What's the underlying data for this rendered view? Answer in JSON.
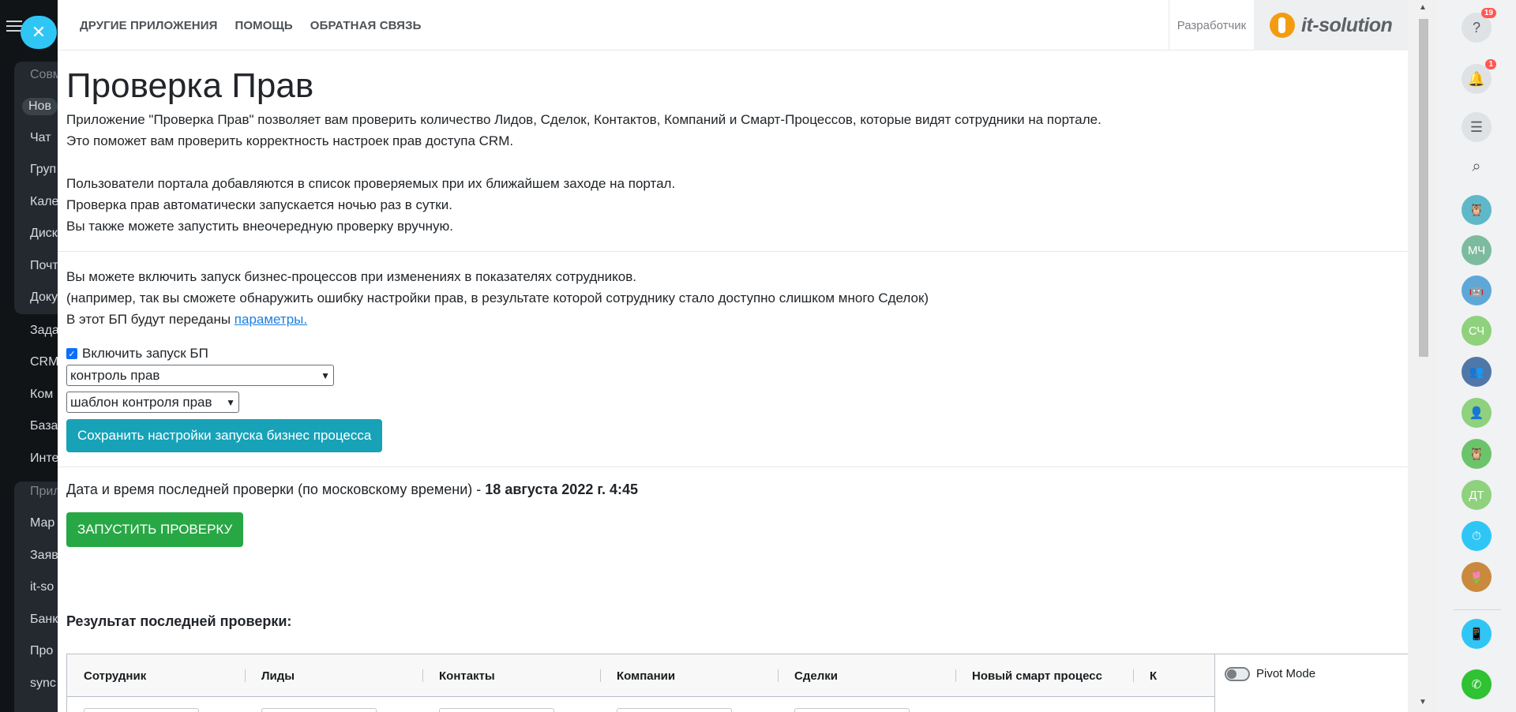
{
  "left_menu": {
    "items": [
      "Совм",
      "Нов",
      "Чат",
      "Груп",
      "Кале",
      "Диск",
      "Почт",
      "Доку",
      "Зада",
      "CRM",
      "Ком",
      "База",
      "Инте",
      "Прил",
      "Мар",
      "Заяв",
      "it-so",
      "Банк",
      "Про",
      "sync"
    ]
  },
  "topnav": {
    "links": [
      "ДРУГИЕ ПРИЛОЖЕНИЯ",
      "ПОМОЩЬ",
      "ОБРАТНАЯ СВЯЗЬ"
    ],
    "developer": "Разработчик",
    "logo": "it-solution"
  },
  "page": {
    "title": "Проверка Прав",
    "intro": [
      "Приложение \"Проверка Прав\" позволяет вам проверить количество Лидов, Сделок, Контактов, Компаний и Смарт-Процессов, которые видят сотрудники на портале.",
      "Это поможет вам проверить корректность настроек прав доступа CRM."
    ],
    "info": [
      "Пользователи портала добавляются в список проверяемых при их ближайшем заходе на портал.",
      "Проверка прав автоматически запускается ночью раз в сутки.",
      "Вы также можете запустить внеочередную проверку вручную."
    ],
    "bp_text": [
      "Вы можете включить запуск бизнес-процессов при изменениях в показателях сотрудников.",
      "(например, так вы сможете обнаружить ошибку настройки прав, в результате которой сотруднику стало доступно слишком много Сделок)"
    ],
    "bp_params_prefix": "В этот БП будут переданы ",
    "bp_params_link": "параметры.",
    "enable_bp_label": "Включить запуск БП",
    "enable_bp_checked": true,
    "select_process": "контроль прав",
    "select_template": "шаблон контроля прав",
    "save_button": "Сохранить настройки запуска бизнес процесса",
    "last_check_label": "Дата и время последней проверки (по московскому времени) - ",
    "last_check_value": "18 августа 2022 г. 4:45",
    "run_button": "ЗАПУСТИТЬ ПРОВЕРКУ",
    "result_title": "Результат последней проверки:"
  },
  "grid": {
    "columns": [
      "Сотрудник",
      "Лиды",
      "Контакты",
      "Компании",
      "Сделки",
      "Новый смарт процесс",
      "К"
    ],
    "pivot_label": "Pivot Mode"
  },
  "right_bar": {
    "help_badge": "19",
    "notify_badge": "1",
    "avatars": [
      "МЧ",
      "СЧ",
      "ДТ"
    ]
  },
  "colors": {
    "accent_teal": "#17a2b8",
    "accent_green": "#28a745",
    "bitrix_blue": "#2fc6f6"
  }
}
